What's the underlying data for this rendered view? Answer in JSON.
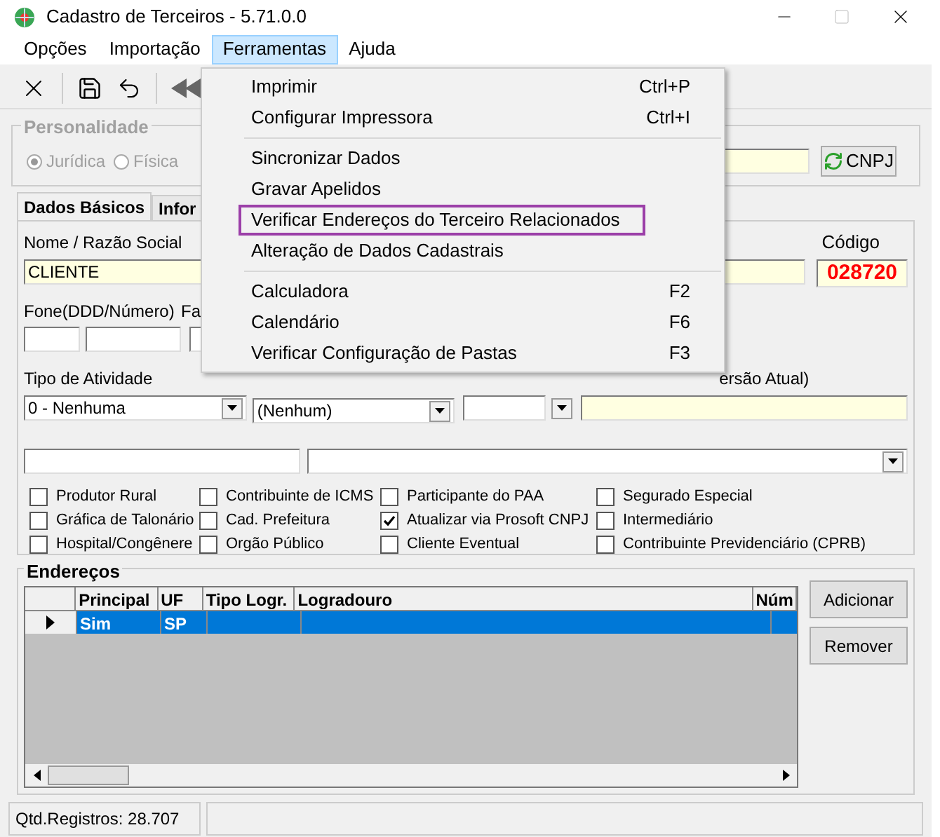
{
  "window": {
    "title": "Cadastro de Terceiros - 5.71.0.0"
  },
  "menu_bar": [
    {
      "label": "Opções",
      "selected": false
    },
    {
      "label": "Importação",
      "selected": false
    },
    {
      "label": "Ferramentas",
      "selected": true
    },
    {
      "label": "Ajuda",
      "selected": false
    }
  ],
  "dropdown_menu": [
    {
      "kind": "item",
      "label": "Imprimir",
      "shortcut": "Ctrl+P",
      "selected": false
    },
    {
      "kind": "item",
      "label": "Configurar Impressora",
      "shortcut": "Ctrl+I",
      "selected": false
    },
    {
      "kind": "separator"
    },
    {
      "kind": "item",
      "label": "Sincronizar Dados",
      "selected": false
    },
    {
      "kind": "item",
      "label": "Gravar Apelidos",
      "selected": false
    },
    {
      "kind": "item",
      "label": "Verificar Endereços do Terceiro Relacionados",
      "selected": true
    },
    {
      "kind": "item",
      "label": "Alteração de Dados Cadastrais",
      "selected": false
    },
    {
      "kind": "separator"
    },
    {
      "kind": "item",
      "label": "Calculadora",
      "shortcut": "F2",
      "selected": false
    },
    {
      "kind": "item",
      "label": "Calendário",
      "shortcut": "F6",
      "selected": false
    },
    {
      "kind": "item",
      "label": "Verificar Configuração de Pastas",
      "shortcut": "F3",
      "selected": false
    }
  ],
  "personalidade": {
    "title": "Personalidade",
    "disabled": true,
    "radios": [
      {
        "label": "Jurídica",
        "selected": true
      },
      {
        "label": "Física",
        "selected": false
      }
    ],
    "cnpj_button": "CNPJ"
  },
  "tabs": [
    {
      "label": "Dados Básicos",
      "selected": true
    },
    {
      "label": "Infor",
      "selected": false
    }
  ],
  "form": {
    "nome_label": "Nome / Razão Social",
    "nome_value": "CLIENTE",
    "codigo_label": "Código",
    "codigo_value": "028720",
    "fone_label": "Fone(DDD/Número)",
    "fax_label": "Fa",
    "atividade_label": "Tipo de Atividade",
    "atividade_value": "0 - Nenhuma",
    "combo_value": "(Nenhum)",
    "versao_label": "ersão Atual)"
  },
  "checkboxes": [
    [
      {
        "label": "Produtor Rural",
        "checked": false
      },
      {
        "label": "Gráfica de Talonário",
        "checked": false
      },
      {
        "label": "Hospital/Congênere",
        "checked": false
      }
    ],
    [
      {
        "label": "Contribuinte de ICMS",
        "checked": false
      },
      {
        "label": "Cad. Prefeitura",
        "checked": false
      },
      {
        "label": "Orgão Público",
        "checked": false
      }
    ],
    [
      {
        "label": "Participante do PAA",
        "checked": false
      },
      {
        "label": "Atualizar via Prosoft CNPJ",
        "checked": true
      },
      {
        "label": "Cliente Eventual",
        "checked": false
      }
    ],
    [
      {
        "label": "Segurado Especial",
        "checked": false
      },
      {
        "label": "Intermediário",
        "checked": false
      },
      {
        "label": "Contribuinte Previdenciário (CPRB)",
        "checked": false
      }
    ]
  ],
  "enderecos": {
    "title": "Endereços",
    "columns": [
      "Principal",
      "UF",
      "Tipo Logr.",
      "Logradouro",
      "Núm"
    ],
    "rows": [
      {
        "selected": true,
        "principal": "Sim",
        "uf": "SP"
      }
    ],
    "buttons": [
      "Adicionar",
      "Remover"
    ]
  },
  "status_bar": {
    "registros": "Qtd.Registros: 28.707"
  }
}
